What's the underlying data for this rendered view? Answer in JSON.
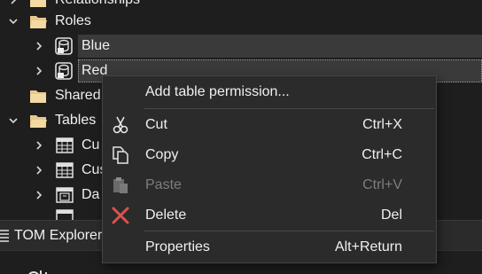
{
  "tree": {
    "relationships_label": "Relationships",
    "roles_label": "Roles",
    "role_blue_label": "Blue",
    "role_red_label": "Red",
    "shared_label": "Shared",
    "tables_label": "Tables",
    "table1_label": "Cu",
    "table2_label": "Cus",
    "table3_label": "Da"
  },
  "bottom": {
    "tab_label": "TOM Explorer"
  },
  "context_menu": {
    "add_permission": "Add table permission...",
    "cut": "Cut",
    "cut_shortcut": "Ctrl+X",
    "copy": "Copy",
    "copy_shortcut": "Ctrl+C",
    "paste": "Paste",
    "paste_shortcut": "Ctrl+V",
    "delete": "Delete",
    "delete_shortcut": "Del",
    "properties": "Properties",
    "properties_shortcut": "Alt+Return"
  },
  "icons": {
    "folder": "folder-icon",
    "role": "role-icon",
    "table": "table-icon",
    "calendar_table": "calendar-table-icon",
    "cut": "scissors-icon",
    "copy": "copy-icon",
    "paste": "paste-icon",
    "delete": "delete-x-icon"
  },
  "colors": {
    "background": "#1e1e1e",
    "menu_background": "#2b2b2b",
    "selection": "#3a3a3a",
    "folder": "#e8c98a",
    "delete_red": "#d9534f",
    "disabled_text": "#7d7d7d"
  }
}
